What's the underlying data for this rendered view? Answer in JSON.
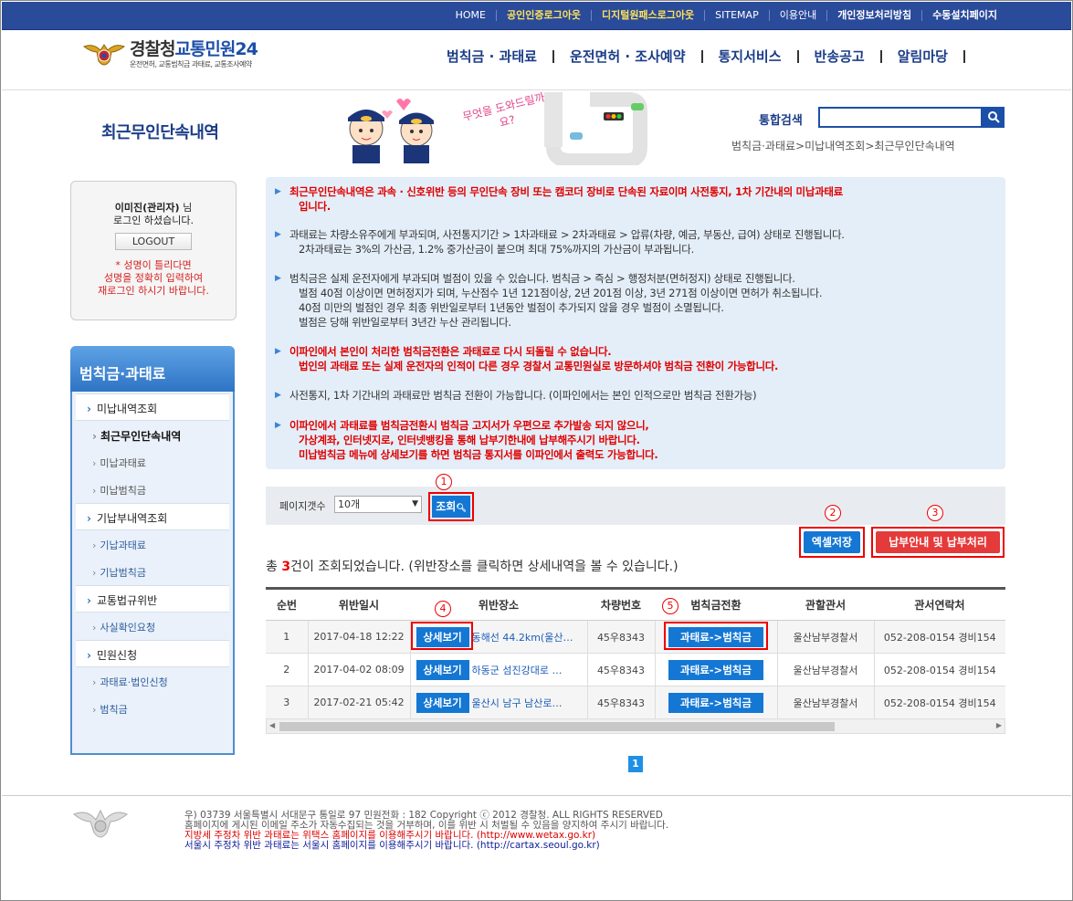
{
  "topnav": {
    "home": "HOME",
    "cert_logout": "공인인증로그아웃",
    "digital_logout": "디지털원패스로그아웃",
    "sitemap": "SITEMAP",
    "guide": "이용안내",
    "privacy": "개인정보처리방침",
    "manual_install": "수동설치페이지"
  },
  "logo": {
    "title_part1": "경찰청",
    "title_part2": "교통민원24",
    "subtitle": "운전면허, 교통범칙금 과태료, 교통조사예약"
  },
  "gnb": [
    "범칙금 · 과태료",
    "운전면허 · 조사예약",
    "통지서비스",
    "반송공고",
    "알림마당"
  ],
  "page_title": "최근무인단속내역",
  "visual_text": "무엇을 도와드릴까요?",
  "search": {
    "label": "통합검색",
    "value": ""
  },
  "breadcrumb": "범칙금·과태료>미납내역조회>최근무인단속내역",
  "login": {
    "name": "이미진(관리자)",
    "suffix": "님",
    "line2": "로그인 하셨습니다.",
    "logout": "LOGOUT",
    "warn1": "* 성명이 틀리다면",
    "warn2": "성명을 정확히 입력하여",
    "warn3": "재로그인 하시기 바랍니다."
  },
  "sidebar": {
    "header": "범칙금·과태료",
    "items": [
      {
        "label": "미납내역조회",
        "level": 1
      },
      {
        "label": "최근무인단속내역",
        "level": 2,
        "active": true
      },
      {
        "label": "미납과태료",
        "level": 2
      },
      {
        "label": "미납범칙금",
        "level": 2
      },
      {
        "label": "기납부내역조회",
        "level": 1
      },
      {
        "label": "기납과태료",
        "level": 2
      },
      {
        "label": "기납범칙금",
        "level": 2
      },
      {
        "label": "교통법규위반",
        "level": 1
      },
      {
        "label": "사실확인요청",
        "level": 2
      },
      {
        "label": "민원신청",
        "level": 1
      },
      {
        "label": "과태료·법인신청",
        "level": 2
      },
      {
        "label": "범칙금",
        "level": 2
      }
    ]
  },
  "info": {
    "p1_l1": "최근무인단속내역은 과속 · 신호위반 등의 무인단속 장비 또는 캠코더 장비로 단속된 자료이며 사전통지, 1차 기간내의 미납과태료",
    "p1_l2": "입니다.",
    "p2_l1": "과태료는 차량소유주에게 부과되며, 사전통지기간 > 1차과태료 > 2차과태료 > 압류(차량, 예금, 부동산, 급여) 상태로 진행됩니다.",
    "p2_l2": "2차과태료는 3%의 가산금, 1.2% 중가산금이 붙으며 최대 75%까지의 가산금이 부과됩니다.",
    "p3_l1": "범칙금은 실제 운전자에게 부과되며 벌점이 있을 수 있습니다. 범칙금 > 즉심 > 행정처분(면허정지) 상태로 진행됩니다.",
    "p3_l2": "벌점 40점 이상이면 면허정지가 되며, 누산점수 1년 121점이상, 2년 201점 이상, 3년 271점 이상이면 면허가 취소됩니다.",
    "p3_l3": "40점 미만의 벌점인 경우 최종 위반일로부터 1년동안 벌점이 추가되지 않을 경우 벌점이 소멸됩니다.",
    "p3_l4": "벌점은 당해 위반일로부터 3년간 누산 관리됩니다.",
    "p4_l1": "이파인에서 본인이 처리한 범칙금전환은 과태료로 다시 되돌릴 수 없습니다.",
    "p4_l2": "법인의 과태료 또는 실제 운전자의 인적이 다른 경우 경찰서 교통민원실로 방문하셔야 범칙금 전환이 가능합니다.",
    "p5_l1": "사전통지, 1차 기간내의 과태료만 범칙금 전환이 가능합니다. (이파인에서는 본인 인적으로만 범칙금 전환가능)",
    "p6_l1": "이파인에서 과태료를 범칙금전환시 범칙금 고지서가 우편으로 추가발송 되지 않으니,",
    "p6_l2": "가상계좌, 인터넷지로, 인터넷뱅킹을 통해 납부기한내에 납부해주시기 바랍니다.",
    "p6_l3": "미납범칙금 메뉴에 상세보기를 하면 범칙금 통지서를 이파인에서 출력도 가능합니다."
  },
  "filter": {
    "label": "페이지갯수",
    "select_value": "10개",
    "search_btn": "조회"
  },
  "buttons": {
    "excel": "엑셀저장",
    "pay": "납부안내 및 납부처리"
  },
  "annotations": [
    "1",
    "2",
    "3",
    "4",
    "5"
  ],
  "total": {
    "prefix": "총 ",
    "count": "3",
    "suffix": "건이 조회되었습니다. (위반장소를 클릭하면 상세내역을 볼 수 있습니다.)"
  },
  "table": {
    "headers": [
      "순번",
      "위반일시",
      "위반장소",
      "차량번호",
      "범칙금전환",
      "관할관서",
      "관서연락처"
    ],
    "detail_btn": "상세보기",
    "convert_btn": "과태료->범칙금",
    "rows": [
      {
        "no": "1",
        "datetime": "2017-04-18 12:22",
        "place": "동해선 44.2km(울산…",
        "car": "45우8343",
        "office": "울산남부경찰서",
        "phone": "052-208-0154 경비154"
      },
      {
        "no": "2",
        "datetime": "2017-04-02 08:09",
        "place": "하동군 섬진강대로 …",
        "car": "45우8343",
        "office": "울산남부경찰서",
        "phone": "052-208-0154 경비154"
      },
      {
        "no": "3",
        "datetime": "2017-02-21 05:42",
        "place": "울산시 남구 남산로…",
        "car": "45우8343",
        "office": "울산남부경찰서",
        "phone": "052-208-0154 경비154"
      }
    ]
  },
  "pager": {
    "current": "1"
  },
  "footer": {
    "l1": "우) 03739 서울특별시 서대문구 통일로 97 민원전화 : 182        Copyright ⓒ 2012 경찰청. ALL RIGHTS RESERVED",
    "l2": "홈페이지에 게시된 이메일 주소가 자동수집되는 것을 거부하며, 이를 위반 시 처벌될 수 있음을 양지하여 주시기 바랍니다.",
    "l3": "지방세 주정차 위반 과태료는 위택스 홈페이지를 이용해주시기 바랍니다. (http://www.wetax.go.kr)",
    "l4": "서울시 주정차 위반 과태료는 서울시 홈페이지를 이용해주시기 바랍니다. (http://cartax.seoul.go.kr)"
  },
  "colors": {
    "brand_navy": "#2a4a9a",
    "accent_blue": "#1477d4",
    "alert_red": "#e00000",
    "pay_red": "#e53a3a"
  }
}
